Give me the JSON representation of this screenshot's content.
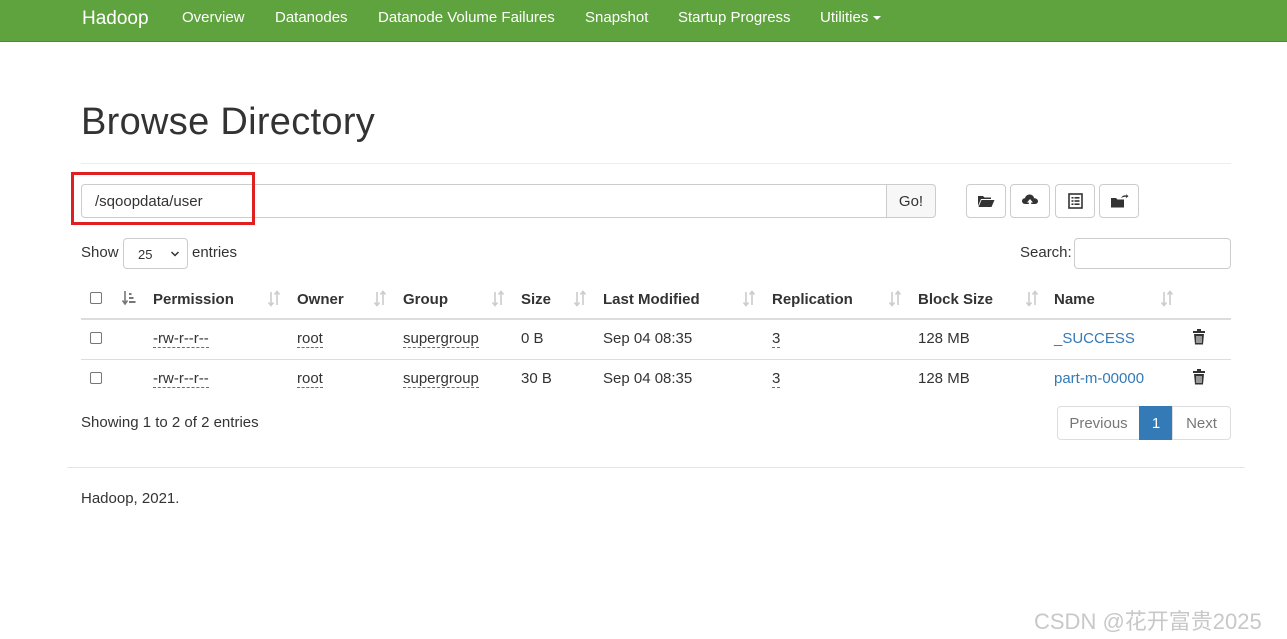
{
  "nav": {
    "brand": "Hadoop",
    "links": [
      "Overview",
      "Datanodes",
      "Datanode Volume Failures",
      "Snapshot",
      "Startup Progress",
      "Utilities"
    ]
  },
  "page_title": "Browse Directory",
  "path": {
    "value": "/sqoopdata/user",
    "go_label": "Go!"
  },
  "toolbar": {
    "icons": [
      "folder-open-icon",
      "cloud-upload-icon",
      "list-alt-icon",
      "folder-share-icon"
    ]
  },
  "show": {
    "prefix": "Show",
    "selected": "25",
    "suffix": "entries"
  },
  "search": {
    "label": "Search:",
    "value": ""
  },
  "table": {
    "columns": [
      "Permission",
      "Owner",
      "Group",
      "Size",
      "Last Modified",
      "Replication",
      "Block Size",
      "Name"
    ],
    "rows": [
      {
        "permission": "-rw-r--r--",
        "owner": "root",
        "group": "supergroup",
        "size": "0 B",
        "modified": "Sep 04 08:35",
        "replication": "3",
        "block_size": "128 MB",
        "name": "_SUCCESS"
      },
      {
        "permission": "-rw-r--r--",
        "owner": "root",
        "group": "supergroup",
        "size": "30 B",
        "modified": "Sep 04 08:35",
        "replication": "3",
        "block_size": "128 MB",
        "name": "part-m-00000"
      }
    ]
  },
  "info": "Showing 1 to 2 of 2 entries",
  "pagination": {
    "previous": "Previous",
    "current": "1",
    "next": "Next"
  },
  "footer": "Hadoop, 2021.",
  "watermark": "CSDN @花开富贵2025",
  "colors": {
    "navbar": "#5fa33e",
    "link": "#337ab7",
    "highlight": "#e02020"
  }
}
